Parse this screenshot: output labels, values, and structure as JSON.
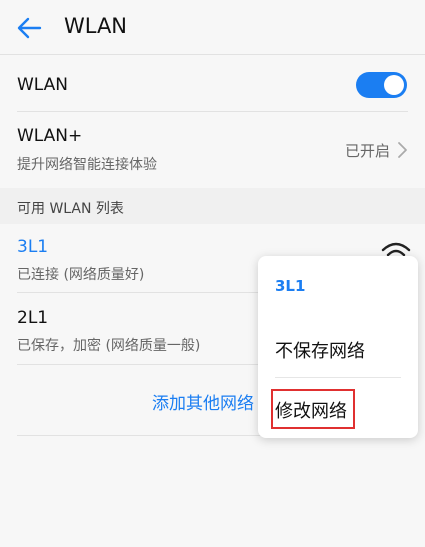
{
  "header": {
    "title": "WLAN"
  },
  "wlan_row": {
    "label": "WLAN",
    "enabled": true
  },
  "wlan_plus": {
    "label": "WLAN+",
    "subtitle": "提升网络智能连接体验",
    "status": "已开启"
  },
  "section": {
    "label": "可用 WLAN 列表"
  },
  "networks": [
    {
      "ssid": "3L1",
      "status": "已连接 (网络质量好)",
      "connected": true
    },
    {
      "ssid": "2L1",
      "status": "已保存，加密 (网络质量一般)",
      "connected": false
    }
  ],
  "add_network": {
    "label": "添加其他网络"
  },
  "context_menu": {
    "title": "3L1",
    "items": [
      {
        "label": "不保存网络"
      },
      {
        "label": "修改网络"
      }
    ]
  },
  "colors": {
    "accent": "#1b7ef2",
    "highlight": "#e03030"
  },
  "icons": [
    "back-arrow-icon",
    "chevron-right-icon",
    "wifi-icon"
  ]
}
